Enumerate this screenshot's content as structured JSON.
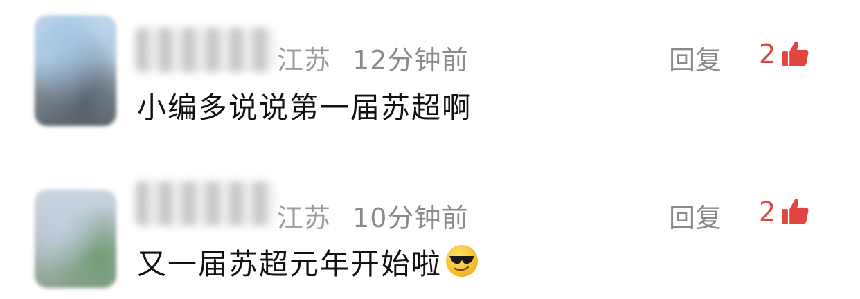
{
  "comments": [
    {
      "region": "江苏",
      "time": "12分钟前",
      "text": "小编多说说第一届苏超啊",
      "reply_label": "回复",
      "like_count": "2",
      "emoji": ""
    },
    {
      "region": "江苏",
      "time": "10分钟前",
      "text": "又一届苏超元年开始啦",
      "reply_label": "回复",
      "like_count": "2",
      "emoji": "sunglasses-emoji"
    }
  ],
  "colors": {
    "meta_gray": "#8a8a8a",
    "like_red": "#e0453f",
    "text_black": "#111111"
  },
  "icons": {
    "like": "thumbs-up-icon",
    "emoji": "sunglasses-emoji"
  }
}
